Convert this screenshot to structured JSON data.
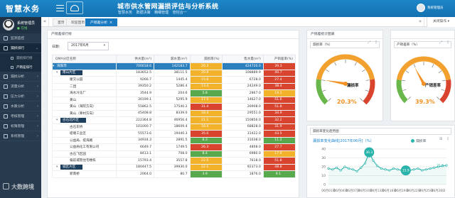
{
  "app": {
    "brand": "智慧水务",
    "title": "城市供水管网漏损评估与分析系统",
    "subtitle": "智慧水务 数据决策 精细管理 管控合一",
    "user": "系统管理员"
  },
  "sidebar": {
    "profile_name": "系统管理员",
    "profile_status": "● 在线",
    "items": [
      {
        "label": "监测监控"
      },
      {
        "label": "漏损排行",
        "active": true
      },
      {
        "label": "漏损排行榜",
        "sub": true,
        "active": false
      },
      {
        "label": "产销差排行",
        "sub": true,
        "active": true
      },
      {
        "label": "漏损分析"
      },
      {
        "label": "流量分析"
      },
      {
        "label": "压力分析"
      },
      {
        "label": "水质分析"
      },
      {
        "label": "考核管理"
      },
      {
        "label": "权限管理"
      },
      {
        "label": "系统管理"
      }
    ]
  },
  "tabs": {
    "items": [
      "首页",
      "欢迎首页",
      "产销差分析"
    ],
    "close_all": "关闭操作 ▾"
  },
  "table_panel": {
    "title": "产销差排行榜",
    "date_label": "日期:",
    "date_value": "2017年6月",
    "columns": [
      "DMA分区名称",
      "供水量(m³)",
      "漏水量(m³)",
      "漏损率(%)",
      "售水量(m³)",
      "产销差率(%)"
    ],
    "rows": [
      {
        "level": 1,
        "name": "海阳市",
        "supply": "700018.6",
        "leak": "142183.7",
        "rate": "20.3",
        "sold": "424720.0",
        "diff": "39.3",
        "rate_color": "#f2b22a",
        "diff_color": "#d9442f"
      },
      {
        "level": 2,
        "name": "南山片区",
        "supply": "183652.5",
        "leak": "38111.5",
        "rate": "20.8",
        "sold": "108889.9",
        "diff": "40.7",
        "rate_color": "#f2b22a",
        "diff_color": "#d9442f"
      },
      {
        "level": 3,
        "name": "厦交公园",
        "supply": "9266.7",
        "leak": "1445.4",
        "rate": "15.6",
        "sold": "6728.0",
        "diff": "27.4",
        "rate_color": "#f2b22a",
        "diff_color": "#d9442f"
      },
      {
        "level": 3,
        "name": "二团",
        "supply": "39350.2",
        "leak": "5286.4",
        "rate": "13.4",
        "sold": "24249.0",
        "diff": "38.4",
        "rate_color": "#f2b22a",
        "diff_color": "#d9442f"
      },
      {
        "level": 3,
        "name": "海水冷冻厂",
        "supply": "3544.9",
        "leak": "204.6",
        "rate": "5.8",
        "sold": "2867.0",
        "diff": "19.1",
        "rate_color": "#58a84d",
        "diff_color": "#f2b22a"
      },
      {
        "level": 3,
        "name": "黄山",
        "supply": "30199.1",
        "leak": "5295.9",
        "rate": "17.5",
        "sold": "14627.0",
        "diff": "51.6",
        "rate_color": "#f2b22a",
        "diff_color": "#d9442f"
      },
      {
        "level": 3,
        "name": "黄山（海院方向）",
        "supply": "55862.5",
        "leak": "17540.2",
        "rate": "31.4",
        "sold": "26908.0",
        "diff": "51.8",
        "rate_color": "#d9442f",
        "diff_color": "#d9442f"
      },
      {
        "level": 3,
        "name": "黄山（幸村方向）",
        "supply": "45408.8",
        "leak": "8339.0",
        "rate": "18.4",
        "sold": "29551.0",
        "diff": "34.9",
        "rate_color": "#f2b22a",
        "diff_color": "#d9442f"
      },
      {
        "level": 2,
        "name": "古石北片区",
        "supply": "222364.8",
        "leak": "46956.4",
        "rate": "21.1",
        "sold": "150856.0",
        "diff": "32.2",
        "rate_color": "#f2b22a",
        "diff_color": "#d9442f"
      },
      {
        "level": 3,
        "name": "古石东桥",
        "supply": "101000.7",
        "leak": "18609.4",
        "rate": "18.4",
        "sold": "68828.0",
        "diff": "31.9",
        "rate_color": "#f2b22a",
        "diff_color": "#d9442f"
      },
      {
        "level": 3,
        "name": "堤塘工业区",
        "supply": "55573.6",
        "leak": "19440.3",
        "rate": "35.0",
        "sold": "31422.0",
        "diff": "43.5",
        "rate_color": "#d9442f",
        "diff_color": "#d9442f"
      },
      {
        "level": 3,
        "name": "公益局、堤海路",
        "supply": "34934.3",
        "leak": "2891.5",
        "rate": "8.3",
        "sold": "31038.0",
        "diff": "11.2",
        "rate_color": "#58a84d",
        "diff_color": "#58a84d"
      },
      {
        "level": 3,
        "name": "公益局化工有限公司",
        "supply": "6649.7",
        "leak": "1749.5",
        "rate": "26.3",
        "sold": "4808.0",
        "diff": "27.7",
        "rate_color": "#d9442f",
        "diff_color": "#d9442f"
      },
      {
        "level": 3,
        "name": "古石飞区园",
        "supply": "8413.1",
        "leak": "708.0",
        "rate": "8.4",
        "sold": "6980.0",
        "diff": "17.0",
        "rate_color": "#58a84d",
        "diff_color": "#f2b22a"
      },
      {
        "level": 3,
        "name": "偏前城管住宅楼栋",
        "supply": "15793.4",
        "leak": "3557.8",
        "rate": "22.5",
        "sold": "7618.0",
        "diff": "51.8",
        "rate_color": "#f2b22a",
        "diff_color": "#d9442f"
      },
      {
        "level": 2,
        "name": "城区片区",
        "supply": "180447.5",
        "leak": "39930.0",
        "rate": "22.1",
        "sold": "92373.0",
        "diff": "48.8",
        "rate_color": "#f2b22a",
        "diff_color": "#d9442f"
      },
      {
        "level": 3,
        "name": "新南桥",
        "supply": "2064.0",
        "leak": "80.7",
        "rate": "3.9",
        "sold": "1876.0",
        "diff": "9.1",
        "rate_color": "#58a84d",
        "diff_color": "#58a84d"
      }
    ]
  },
  "gauges": {
    "panel_title": "产销差统计图表",
    "leak_title": "漏损率（%）",
    "diff_title": "产销差率（%）",
    "leak_label": "漏损率",
    "diff_label": "产销差率",
    "leak_value": 20.3,
    "diff_value": 39.3,
    "leak_value_text": "20.3%",
    "diff_value_text": "39.3%"
  },
  "chart_data": {
    "type": "line",
    "title": "漏损率变化曲线[2017年06月]（%）",
    "legend": "漏损率",
    "tab_title": "漏损率变化趋势图",
    "x": [
      "06月01日",
      "06月02日",
      "06月03日",
      "06月04日",
      "06月05日",
      "06月06日",
      "06月07日",
      "06月08日",
      "06月09日",
      "06月10日",
      "06月11日",
      "06月12日",
      "06月13日",
      "06月14日",
      "06月15日",
      "06月16日",
      "06月17日",
      "06月18日",
      "06月19日",
      "06月20日",
      "06月21日",
      "06月22日",
      "06月23日",
      "06月24日",
      "06月25日",
      "06月26日",
      "06月27日",
      "06月28日",
      "06月29日",
      "06月30日"
    ],
    "values": [
      18,
      17,
      19,
      16,
      20,
      18,
      17,
      15,
      19,
      24,
      36,
      27,
      21,
      18,
      17,
      16,
      18,
      17,
      16,
      15,
      16,
      17,
      18,
      16,
      17,
      18,
      19,
      20,
      21,
      21.6
    ],
    "yticks": [
      0,
      10,
      20,
      30,
      40
    ],
    "xticks": [
      "06月01日",
      "06月04日",
      "06月07日",
      "06月10日",
      "06月13日",
      "06月16日",
      "06月19日",
      "06月22日",
      "06月25日",
      "06月28日"
    ],
    "ylim": [
      0,
      40
    ],
    "annotations": [
      {
        "text": "36.3",
        "x": "06月11日",
        "y": 36.3
      },
      {
        "text": "15.9",
        "x": "06月20日",
        "y": 15.9
      },
      {
        "text": "21.6",
        "x": "06月30日",
        "y": 21.6
      }
    ]
  },
  "watermark": "大数跨境"
}
